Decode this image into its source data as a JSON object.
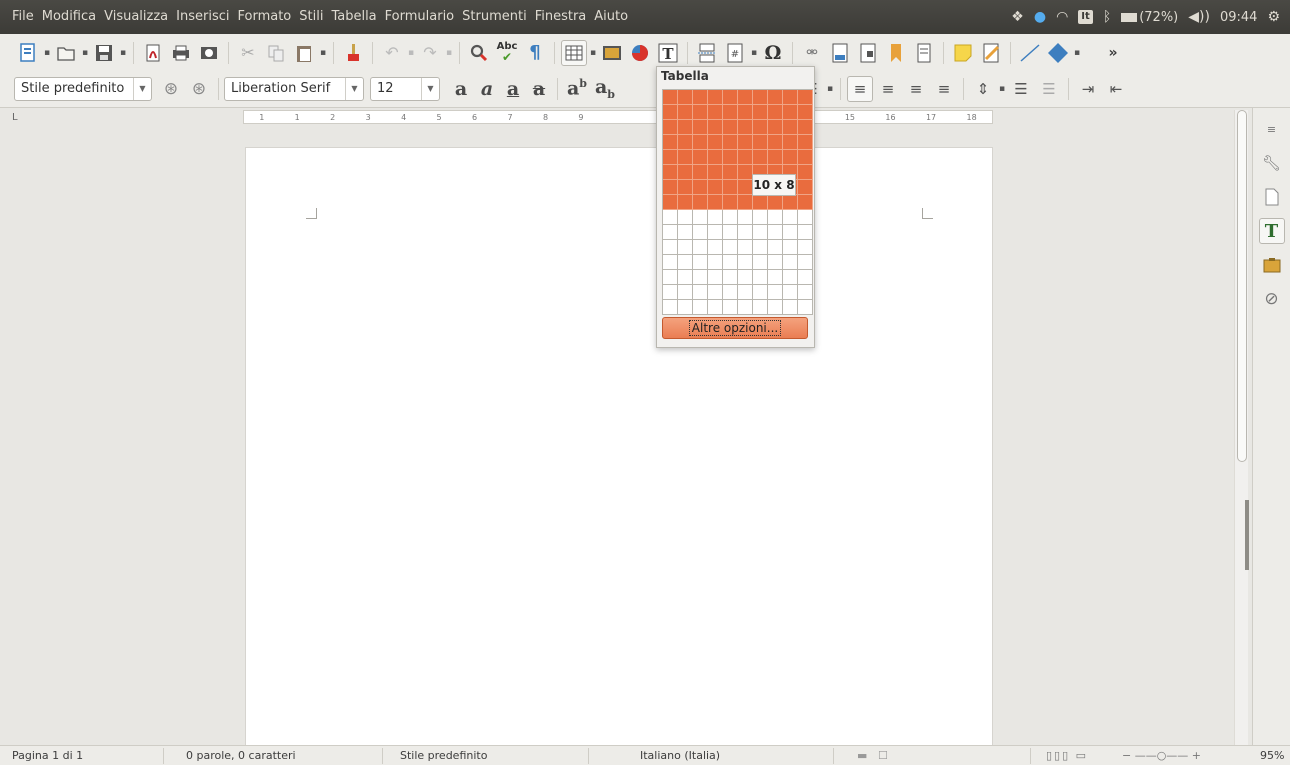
{
  "menubar": {
    "items": [
      "File",
      "Modifica",
      "Visualizza",
      "Inserisci",
      "Formato",
      "Stili",
      "Tabella",
      "Formulario",
      "Strumenti",
      "Finestra",
      "Aiuto"
    ],
    "keyboard_layout": "It",
    "battery": "(72%)",
    "clock": "09:44"
  },
  "formatting": {
    "paragraph_style": "Stile predefinito",
    "font_name": "Liberation Serif",
    "font_size": "12"
  },
  "ruler": {
    "ticks": [
      "1",
      "1",
      "2",
      "3",
      "4",
      "5",
      "6",
      "7",
      "8",
      "9",
      "14",
      "15",
      "16",
      "17",
      "18"
    ]
  },
  "table_popup": {
    "title": "Tabella",
    "selected_cols": 10,
    "selected_rows": 8,
    "total_cols": 10,
    "total_rows": 15,
    "size_label": "10 x 8",
    "more_options": "Altre opzioni...",
    "selection_color": "#e96c3e"
  },
  "statusbar": {
    "page": "Pagina 1 di 1",
    "words": "0 parole, 0 caratteri",
    "page_style": "Stile predefinito",
    "language": "Italiano (Italia)",
    "zoom": "95%"
  },
  "colors": {
    "menubar_bg": "#3c3b37",
    "toolbar_bg": "#edece8",
    "accent": "#e96c3e"
  },
  "icons": {
    "toolbar1": [
      "new-document-icon",
      "open-folder-icon",
      "save-icon",
      "export-pdf-icon",
      "print-icon",
      "print-preview-icon",
      "cut-icon",
      "copy-icon",
      "paste-icon",
      "clone-formatting-icon",
      "undo-icon",
      "redo-icon",
      "find-replace-icon",
      "spelling-icon",
      "formatting-marks-icon",
      "insert-table-icon",
      "insert-image-icon",
      "insert-chart-icon",
      "insert-textbox-icon",
      "page-break-icon",
      "insert-field-icon",
      "special-character-icon",
      "hyperlink-icon",
      "footnote-icon",
      "endnote-icon",
      "bookmark-icon",
      "cross-reference-icon",
      "comment-icon",
      "track-changes-icon",
      "line-icon",
      "basic-shapes-icon",
      "more-icon"
    ],
    "sidebar": [
      "properties-icon",
      "wrench-icon",
      "page-icon",
      "styles-icon",
      "gallery-icon",
      "navigator-icon"
    ]
  }
}
